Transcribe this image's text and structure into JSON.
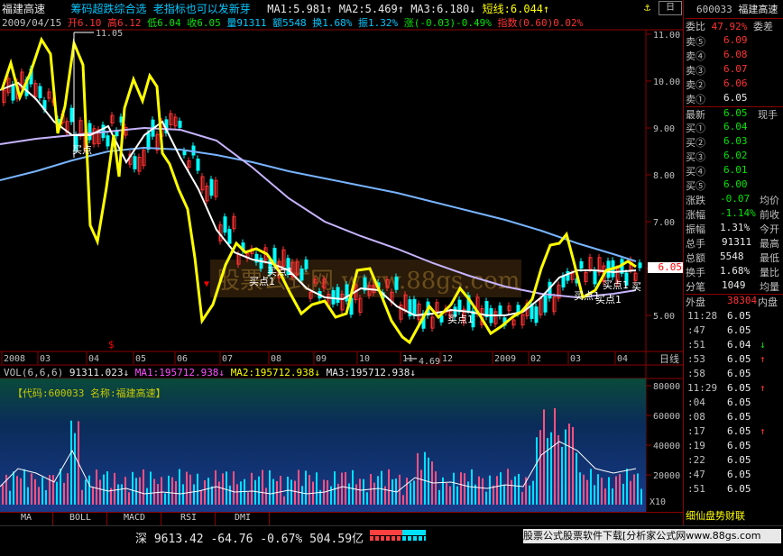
{
  "header": {
    "stock_name": "福建高速",
    "indicator": "筹码超跌综合选",
    "slogan": "老指标也可以发新芽",
    "ma1": "MA1:5.981↑",
    "ma2": "MA2:5.469↑",
    "ma3": "MA3:6.180↓",
    "short": "短线:6.044↑",
    "date": "2009/04/15",
    "open": "开6.10",
    "high": "高6.12",
    "low": "低6.04",
    "close": "收6.05",
    "volume": "量91311",
    "amount": "额5548",
    "turnover": "换1.68%",
    "amplitude": "振1.32%",
    "change": "涨(-0.03)-0.49%",
    "index": "指数(0.60)0.02%"
  },
  "price_axis": [
    "11.00",
    "10.00",
    "9.00",
    "8.00",
    "7.00",
    "6.00",
    "5.00"
  ],
  "price_peak_label": "11.05",
  "price_low_label": "4.69",
  "current_price_tag": "6.05",
  "buy_labels": [
    "买点1",
    "买点1",
    "买点1",
    "买点1",
    "买点1",
    "买点1",
    "买点",
    "买"
  ],
  "watermark": "股票公式网 www.88gs.com",
  "time_axis": [
    "2008",
    "03",
    "04",
    "05",
    "06",
    "07",
    "08",
    "09",
    "10",
    "11",
    "12",
    "2009",
    "02",
    "03",
    "04"
  ],
  "time_axis_right": "日线",
  "volume": {
    "label_main": "VOL(6,6,6)",
    "value": "91311.023↓",
    "ma1": "MA1:195712.938↓",
    "ma2": "MA2:195712.938↓",
    "ma3": "MA3:195712.938↓",
    "code_text": "【代码:600033 名称:福建高速】",
    "axis": [
      "80000",
      "60000",
      "40000",
      "20000"
    ],
    "unit": "X10"
  },
  "tabs": [
    "MA",
    "BOLL",
    "MACD",
    "RSI",
    "DMI"
  ],
  "right_panel": {
    "code": "600033",
    "name": "福建高速",
    "webi_label": "委比",
    "webi_value": "47.92%",
    "wecha_label": "委差",
    "sell": [
      {
        "label": "卖⑤",
        "price": "6.09"
      },
      {
        "label": "卖④",
        "price": "6.08"
      },
      {
        "label": "卖③",
        "price": "6.07"
      },
      {
        "label": "卖②",
        "price": "6.06"
      },
      {
        "label": "卖①",
        "price": "6.05"
      }
    ],
    "latest_label": "最新",
    "latest_value": "6.05",
    "latest_right": "现手",
    "buy": [
      {
        "label": "买①",
        "price": "6.04"
      },
      {
        "label": "买②",
        "price": "6.03"
      },
      {
        "label": "买③",
        "price": "6.02"
      },
      {
        "label": "买④",
        "price": "6.01"
      },
      {
        "label": "买⑤",
        "price": "6.00"
      }
    ],
    "stats": [
      {
        "label": "涨跌",
        "value": "-0.07",
        "right": "均价"
      },
      {
        "label": "涨幅",
        "value": "-1.14%",
        "right": "前收"
      },
      {
        "label": "振幅",
        "value": "1.31%",
        "right": "今开"
      },
      {
        "label": "总手",
        "value": "91311",
        "right": "最高"
      },
      {
        "label": "总额",
        "value": "5548",
        "right": "最低"
      },
      {
        "label": "换手",
        "value": "1.68%",
        "right": "量比"
      },
      {
        "label": "分笔",
        "value": "1049",
        "right": "均量"
      }
    ],
    "outer_label": "外盘",
    "outer_value": "38304",
    "inner_label": "内盘",
    "ticks": [
      {
        "time": "11:28",
        "price": "6.05",
        "arrow": ""
      },
      {
        "time": ":47",
        "price": "6.05",
        "arrow": ""
      },
      {
        "time": ":51",
        "price": "6.04",
        "arrow": "↓"
      },
      {
        "time": ":53",
        "price": "6.05",
        "arrow": "↑"
      },
      {
        "time": ":58",
        "price": "6.05",
        "arrow": ""
      },
      {
        "time": "11:29",
        "price": "6.05",
        "arrow": "↑"
      },
      {
        "time": ":04",
        "price": "6.05",
        "arrow": ""
      },
      {
        "time": ":08",
        "price": "6.05",
        "arrow": ""
      },
      {
        "time": ":17",
        "price": "6.05",
        "arrow": "↑"
      },
      {
        "time": ":19",
        "price": "6.05",
        "arrow": ""
      },
      {
        "time": ":22",
        "price": "6.05",
        "arrow": ""
      },
      {
        "time": ":47",
        "price": "6.05",
        "arrow": ""
      },
      {
        "time": ":51",
        "price": "6.05",
        "arrow": ""
      }
    ],
    "bottom_tabs": "细仙盘势财联"
  },
  "status": {
    "index_name": "深",
    "index_value": "9613.42",
    "index_change": "-64.76",
    "index_pct": "-0.67%",
    "index_amount": "504.59亿",
    "marquee": "股票公式股票软件下载[分析家公式网www.88gs.com"
  },
  "colors": {
    "yellow_line": "#ffff00",
    "white_line": "#ffffff",
    "lavender_line": "#c8b4ff",
    "blue_line": "#78b4ff",
    "up_candle": "#ff3232",
    "down_candle": "#00ffff"
  }
}
